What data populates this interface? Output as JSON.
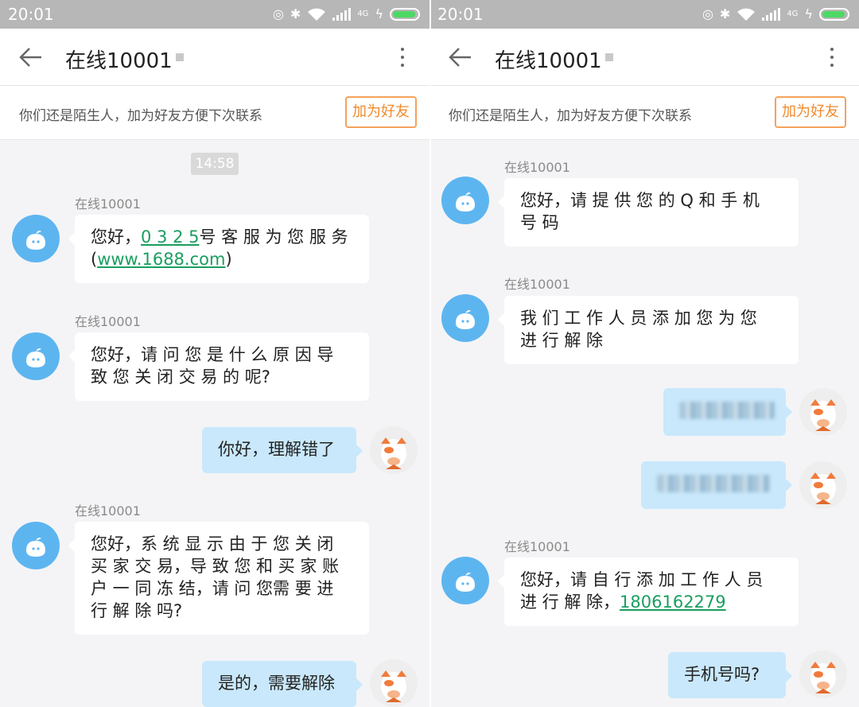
{
  "status_bar": {
    "time": "20:01",
    "network": "4G"
  },
  "header": {
    "title": "在线10001"
  },
  "notice": {
    "text": "你们还是陌生人，加为好友方便下次联系",
    "add_button": "加为好友"
  },
  "left_chat": {
    "timestamp": "14:58",
    "messages": [
      {
        "sender": "在线10001",
        "prefix": "您好，",
        "link1": "0 3 2 5",
        "middle": "号 客 服  为 您 服 务",
        "open": "(",
        "link2": "www.1688.com",
        "close": ")"
      },
      {
        "sender": "在线10001",
        "line1": "您好，请 问 您 是 什 么 原 因 导",
        "line2": "致 您  关 闭 交 易 的 呢?"
      },
      {
        "mine": "你好，理解错了"
      },
      {
        "sender": "在线10001",
        "line1": "您好，系 统 显 示 由 于 您  关 闭",
        "line2": "买 家 交 易，导 致 您  和 买 家 账",
        "line3": "户 一 同 冻 结，请 问 您需 要 进",
        "line4": "行 解 除 吗?"
      },
      {
        "mine": "是的，需要解除"
      }
    ]
  },
  "right_chat": {
    "messages": [
      {
        "sender": "在线10001",
        "line1": "您好，请 提 供 您 的  Q  和 手 机",
        "line2": "号 码"
      },
      {
        "sender": "在线10001",
        "line1": "我 们 工 作 人 员 添 加 您  为 您",
        "line2": "进 行 解 除"
      },
      {
        "sender": "在线10001",
        "line1": "您好，请  自 行 添 加 工 作 人 员",
        "prefix2": "进 行 解 除，",
        "phone": "1806162279"
      },
      {
        "mine": "手机号吗?"
      }
    ]
  },
  "colors": {
    "accent_orange": "#f08a2e",
    "link_green": "#1a9e5f",
    "my_bubble": "#c9e8fb",
    "avatar_blue": "#5db5f0"
  }
}
